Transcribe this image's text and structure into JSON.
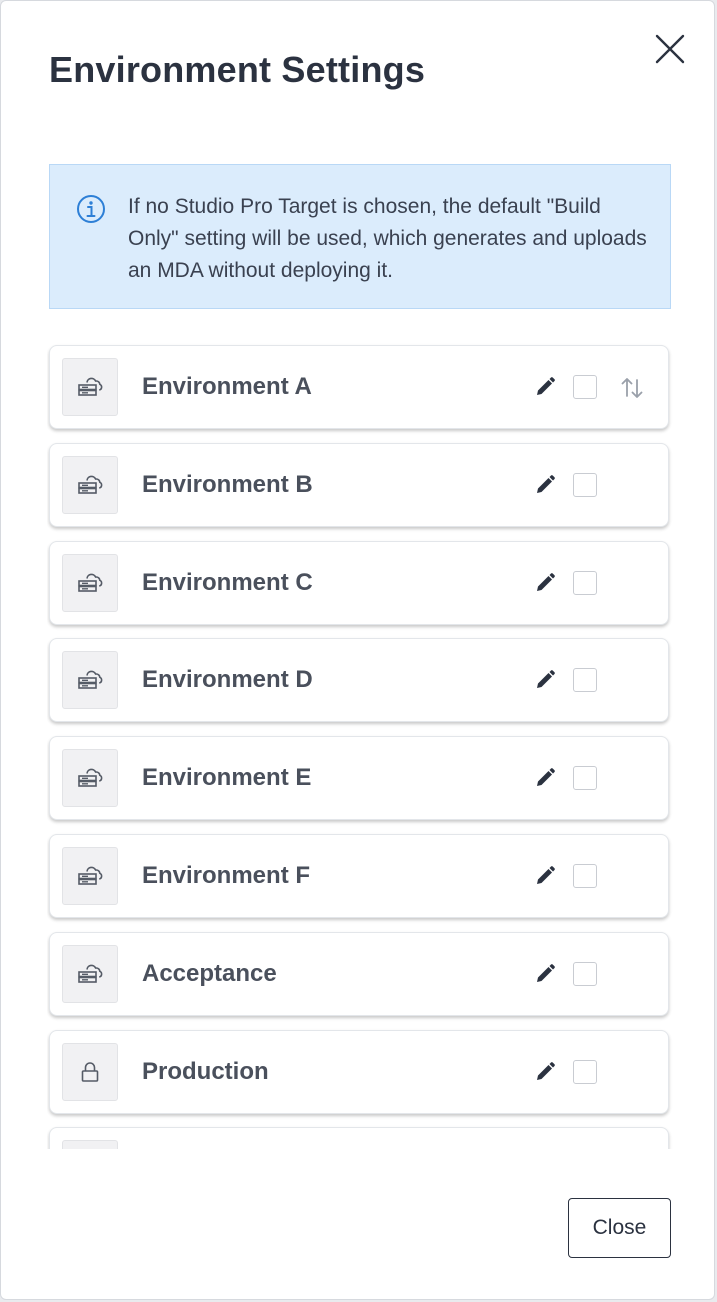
{
  "modal": {
    "title": "Environment Settings",
    "close_icon": "close-icon"
  },
  "info": {
    "icon": "info-circle-icon",
    "text": "If no Studio Pro Target is chosen, the default \"Build Only\" setting will be used, which generates and uploads an MDA without deploying it."
  },
  "environments": [
    {
      "name": "Environment A",
      "icon": "cloud-server-icon",
      "checked": false,
      "show_sort": true
    },
    {
      "name": "Environment B",
      "icon": "cloud-server-icon",
      "checked": false,
      "show_sort": false
    },
    {
      "name": "Environment C",
      "icon": "cloud-server-icon",
      "checked": false,
      "show_sort": false
    },
    {
      "name": "Environment D",
      "icon": "cloud-server-icon",
      "checked": false,
      "show_sort": false
    },
    {
      "name": "Environment E",
      "icon": "cloud-server-icon",
      "checked": false,
      "show_sort": false
    },
    {
      "name": "Environment F",
      "icon": "cloud-server-icon",
      "checked": false,
      "show_sort": false
    },
    {
      "name": "Acceptance",
      "icon": "cloud-server-icon",
      "checked": false,
      "show_sort": false
    },
    {
      "name": "Production",
      "icon": "lock-icon",
      "checked": false,
      "show_sort": false
    }
  ],
  "footer": {
    "close_label": "Close"
  },
  "colors": {
    "info_background": "#dbecfc",
    "info_icon": "#2d7fd6",
    "text_dark": "#2b3240"
  }
}
